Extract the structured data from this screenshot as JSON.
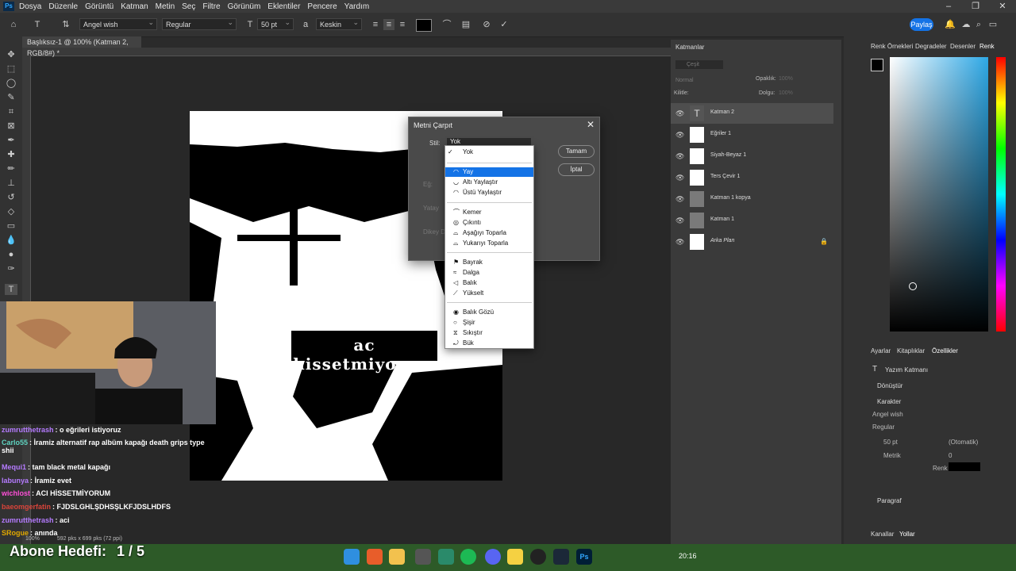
{
  "menubar": {
    "items": [
      "Dosya",
      "Düzenle",
      "Görüntü",
      "Katman",
      "Metin",
      "Seç",
      "Filtre",
      "Görünüm",
      "Eklentiler",
      "Pencere",
      "Yardım"
    ]
  },
  "options": {
    "font_family": "Angel wish",
    "font_style": "Regular",
    "font_size": "50 pt",
    "antialias": "Keskin",
    "share_label": "Paylaş"
  },
  "document": {
    "tab_title": "Başlıksız-1 @ 100% (Katman 2, RGB/8#) *",
    "zoom": "100%",
    "dimensions": "592 pks x 699 pks (72 ppi)"
  },
  "dialog": {
    "title": "Metni Çarpıt",
    "style_label": "Stil:",
    "style_value": "Yok",
    "ok_label": "Tamam",
    "cancel_label": "İptal",
    "bend_label": "Eğ:",
    "horizontal_label": "Yatay",
    "vertical_label": "Dikey D"
  },
  "dropdown": {
    "checked": "Yok",
    "group1": [
      "Yay",
      "Altı Yaylaştır",
      "Üstü Yaylaştır"
    ],
    "group2": [
      "Kemer",
      "Çıkıntı",
      "Aşağıyı Toparla",
      "Yukarıyı Toparla"
    ],
    "group3": [
      "Bayrak",
      "Dalga",
      "Balık",
      "Yükselt"
    ],
    "group4": [
      "Balık Gözü",
      "Şişir",
      "Sıkıştır",
      "Bük"
    ]
  },
  "layers_panel": {
    "tab": "Katmanlar",
    "search_placeholder": "Çeşit",
    "blend_mode": "Normal",
    "opacity_label": "Opaklık:",
    "opacity_value": "100%",
    "lock_label": "Kilitle:",
    "fill_label": "Dolgu:",
    "fill_value": "100%",
    "layers": [
      "Katman 2",
      "Eğriler 1",
      "Siyah-Beyaz 1",
      "Ters Çevir 1",
      "Katman 1 kopya",
      "Katman 1",
      "Arka Plan"
    ]
  },
  "right_tabs": [
    "Renk Örnekleri",
    "Degradeler",
    "Desenler",
    "Renk"
  ],
  "properties": {
    "tabs": [
      "Ayarlar",
      "Kitaplıklar",
      "Özellikler"
    ],
    "layer_type": "Yazım Katmanı",
    "transform_label": "Dönüştür",
    "character_label": "Karakter",
    "font_family": "Angel wish",
    "font_style": "Regular",
    "font_size": "50 pt",
    "leading": "(Otomatik)",
    "kerning": "Metrik",
    "tracking": "0",
    "color_label": "Renk",
    "paragraph_label": "Paragraf",
    "bottom_tabs": [
      "Kanallar",
      "Yollar"
    ]
  },
  "artwork_text": "ac hissetmiyorum",
  "chat": [
    {
      "user": "zumrutthetrash",
      "text": ": o eğrileri istiyoruz",
      "color": "#b57bff"
    },
    {
      "user": "Carlo55",
      "text": ": İramiz alternatif rap albüm kapağı death grips type shii",
      "color": "#5fd3c0"
    },
    {
      "user": "Mequi1",
      "text": ": tam black metal kapağı",
      "color": "#b57bff"
    },
    {
      "user": "labunya",
      "text": ": İramiz evet",
      "color": "#b57bff"
    },
    {
      "user": "wichlost",
      "text": ": ACI HİSSETMİYORUM",
      "color": "#ff4fd8"
    },
    {
      "user": "baeomgerfatin",
      "text": ": FJDSLGHLŞDHSŞLKFJDSLHDFS",
      "color": "#d9443a"
    },
    {
      "user": "zumrutthetrash",
      "text": ": aci",
      "color": "#b57bff"
    },
    {
      "user": "SRogue",
      "text": ": anında",
      "color": "#e0a800"
    }
  ],
  "overlay": {
    "goal_label": "Abone Hedefi:",
    "goal_value": "1 / 5"
  },
  "taskbar": {
    "time": "20:16"
  }
}
